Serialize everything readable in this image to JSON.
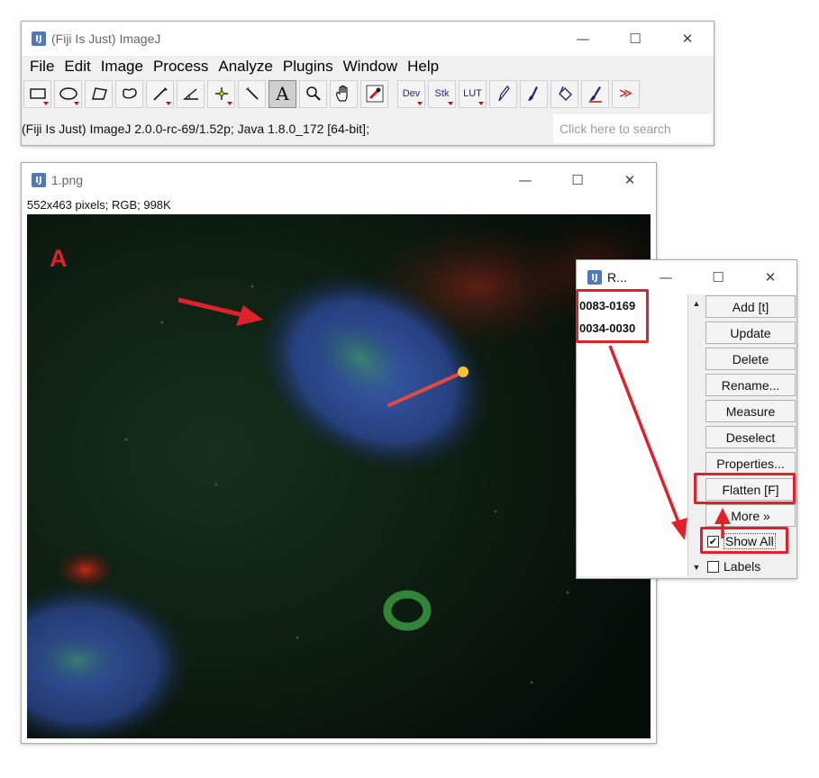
{
  "main_window": {
    "title": "(Fiji Is Just) ImageJ",
    "menu": [
      "File",
      "Edit",
      "Image",
      "Process",
      "Analyze",
      "Plugins",
      "Window",
      "Help"
    ],
    "status": "(Fiji Is Just) ImageJ 2.0.0-rc-69/1.52p; Java 1.8.0_172 [64-bit];",
    "search_placeholder": "Click here to search",
    "toolbar": {
      "dev": "Dev",
      "stk": "Stk",
      "lut": "LUT",
      "more": "≫"
    }
  },
  "image_window": {
    "title": "1.png",
    "info": "552x463 pixels; RGB; 998K",
    "panel_label": "A"
  },
  "roi_manager": {
    "title": "R...",
    "items": [
      "0083-0169",
      "0034-0030"
    ],
    "buttons": [
      "Add [t]",
      "Update",
      "Delete",
      "Rename...",
      "Measure",
      "Deselect",
      "Properties...",
      "Flatten [F]",
      "More »"
    ],
    "show_all": "Show All",
    "labels": "Labels",
    "show_all_checked": true,
    "labels_checked": false
  },
  "colors": {
    "annotation_red": "#e0202a",
    "nucleus_blue": "#2e4f9e",
    "signal_green": "#3fa845"
  }
}
